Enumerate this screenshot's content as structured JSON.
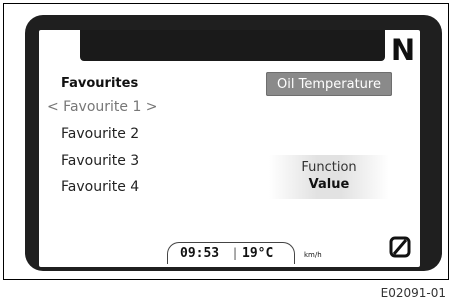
{
  "gear": "N",
  "favourites": {
    "title": "Favourites",
    "active": "< Favourite 1 >",
    "items": [
      "Favourite 2",
      "Favourite 3",
      "Favourite 4"
    ]
  },
  "oil_button": "Oil Temperature",
  "function": {
    "label": "Function",
    "value": "Value"
  },
  "status": {
    "time": "09:53",
    "separator": "|",
    "temperature": "19°C",
    "speed_unit": "km/h"
  },
  "icons": {
    "zero": "zero-slash-icon"
  },
  "figure_id": "E02091-01"
}
